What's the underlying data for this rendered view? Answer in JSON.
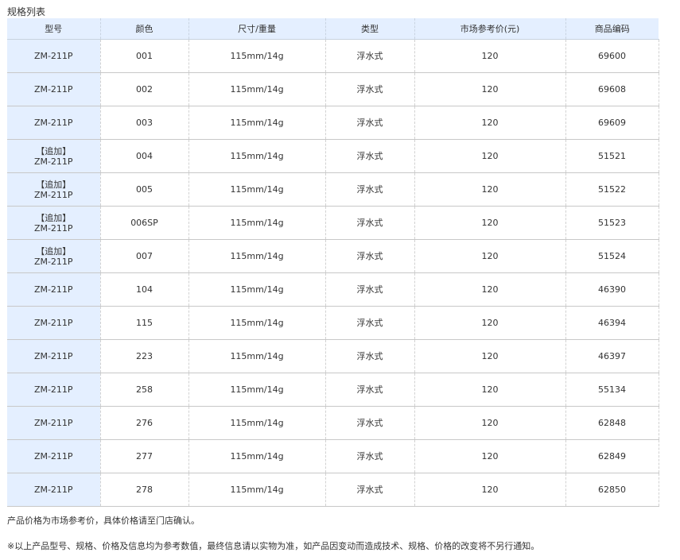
{
  "section_title": "规格列表",
  "table": {
    "headers": [
      "型号",
      "颜色",
      "尺寸/重量",
      "类型",
      "市场参考价(元)",
      "商品编码"
    ],
    "rows": [
      {
        "tag": "",
        "model": "ZM-211P",
        "color": "001",
        "size": "115mm/14g",
        "type": "浮水式",
        "price": "120",
        "code": "69600"
      },
      {
        "tag": "",
        "model": "ZM-211P",
        "color": "002",
        "size": "115mm/14g",
        "type": "浮水式",
        "price": "120",
        "code": "69608"
      },
      {
        "tag": "",
        "model": "ZM-211P",
        "color": "003",
        "size": "115mm/14g",
        "type": "浮水式",
        "price": "120",
        "code": "69609"
      },
      {
        "tag": "【追加】",
        "model": "ZM-211P",
        "color": "004",
        "size": "115mm/14g",
        "type": "浮水式",
        "price": "120",
        "code": "51521"
      },
      {
        "tag": "【追加】",
        "model": "ZM-211P",
        "color": "005",
        "size": "115mm/14g",
        "type": "浮水式",
        "price": "120",
        "code": "51522"
      },
      {
        "tag": "【追加】",
        "model": "ZM-211P",
        "color": "006SP",
        "size": "115mm/14g",
        "type": "浮水式",
        "price": "120",
        "code": "51523"
      },
      {
        "tag": "【追加】",
        "model": "ZM-211P",
        "color": "007",
        "size": "115mm/14g",
        "type": "浮水式",
        "price": "120",
        "code": "51524"
      },
      {
        "tag": "",
        "model": "ZM-211P",
        "color": "104",
        "size": "115mm/14g",
        "type": "浮水式",
        "price": "120",
        "code": "46390"
      },
      {
        "tag": "",
        "model": "ZM-211P",
        "color": "115",
        "size": "115mm/14g",
        "type": "浮水式",
        "price": "120",
        "code": "46394"
      },
      {
        "tag": "",
        "model": "ZM-211P",
        "color": "223",
        "size": "115mm/14g",
        "type": "浮水式",
        "price": "120",
        "code": "46397"
      },
      {
        "tag": "",
        "model": "ZM-211P",
        "color": "258",
        "size": "115mm/14g",
        "type": "浮水式",
        "price": "120",
        "code": "55134"
      },
      {
        "tag": "",
        "model": "ZM-211P",
        "color": "276",
        "size": "115mm/14g",
        "type": "浮水式",
        "price": "120",
        "code": "62848"
      },
      {
        "tag": "",
        "model": "ZM-211P",
        "color": "277",
        "size": "115mm/14g",
        "type": "浮水式",
        "price": "120",
        "code": "62849"
      },
      {
        "tag": "",
        "model": "ZM-211P",
        "color": "278",
        "size": "115mm/14g",
        "type": "浮水式",
        "price": "120",
        "code": "62850"
      }
    ]
  },
  "notes": {
    "price_note": "产品价格为市场参考价，具体价格请至门店确认。",
    "disclaimer": "※以上产品型号、规格、价格及信息均为参考数值，最终信息请以实物为准，如产品因变动而造成技术、规格、价格的改变将不另行通知。"
  }
}
